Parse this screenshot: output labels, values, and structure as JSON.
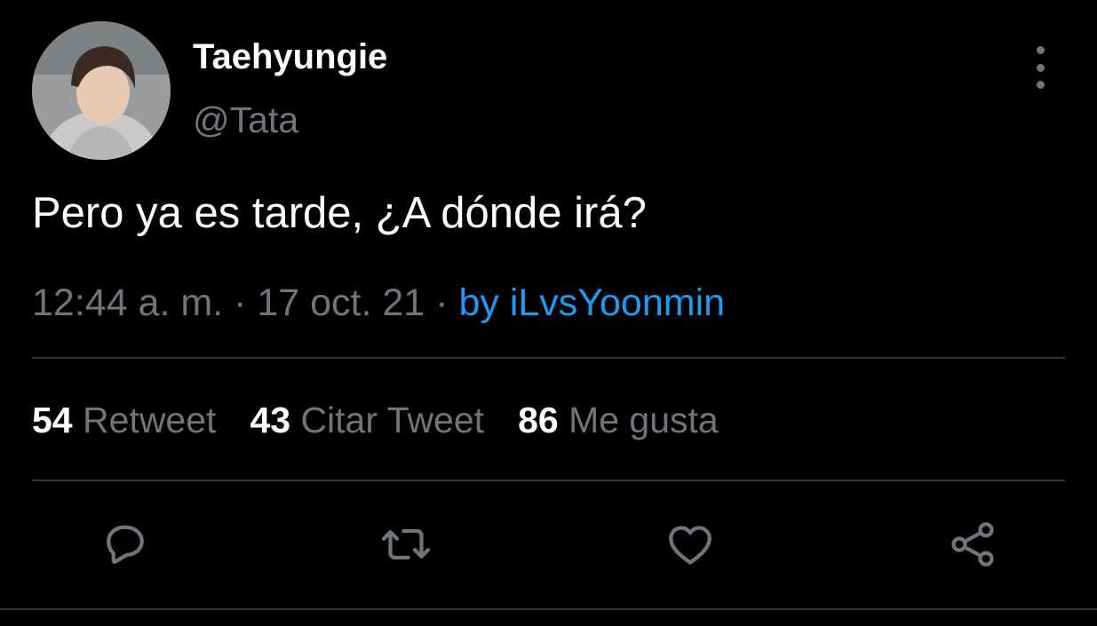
{
  "tweet": {
    "author": {
      "display_name": "Taehyungie",
      "handle": "@Tata",
      "avatar_icon": "profile-photo"
    },
    "text": "Pero ya es tarde, ¿A dónde irá?",
    "meta": {
      "time": "12:44 a. m.",
      "separator": " · ",
      "date": "17 oct. 21",
      "source_separator": " · ",
      "source": "by iLvsYoonmin"
    },
    "stats": {
      "retweets": {
        "count": "54",
        "label": "Retweet"
      },
      "quotes": {
        "count": "43",
        "label": "Citar Tweet"
      },
      "likes": {
        "count": "86",
        "label": "Me gusta"
      }
    },
    "actions": [
      "reply-icon",
      "retweet-icon",
      "like-icon",
      "share-icon"
    ],
    "more_icon": "more-vertical-icon"
  },
  "colors": {
    "background": "#000000",
    "primary_text": "#ffffff",
    "secondary_text": "#6e767d",
    "accent": "#1d9bf0",
    "divider": "#2f3336"
  }
}
